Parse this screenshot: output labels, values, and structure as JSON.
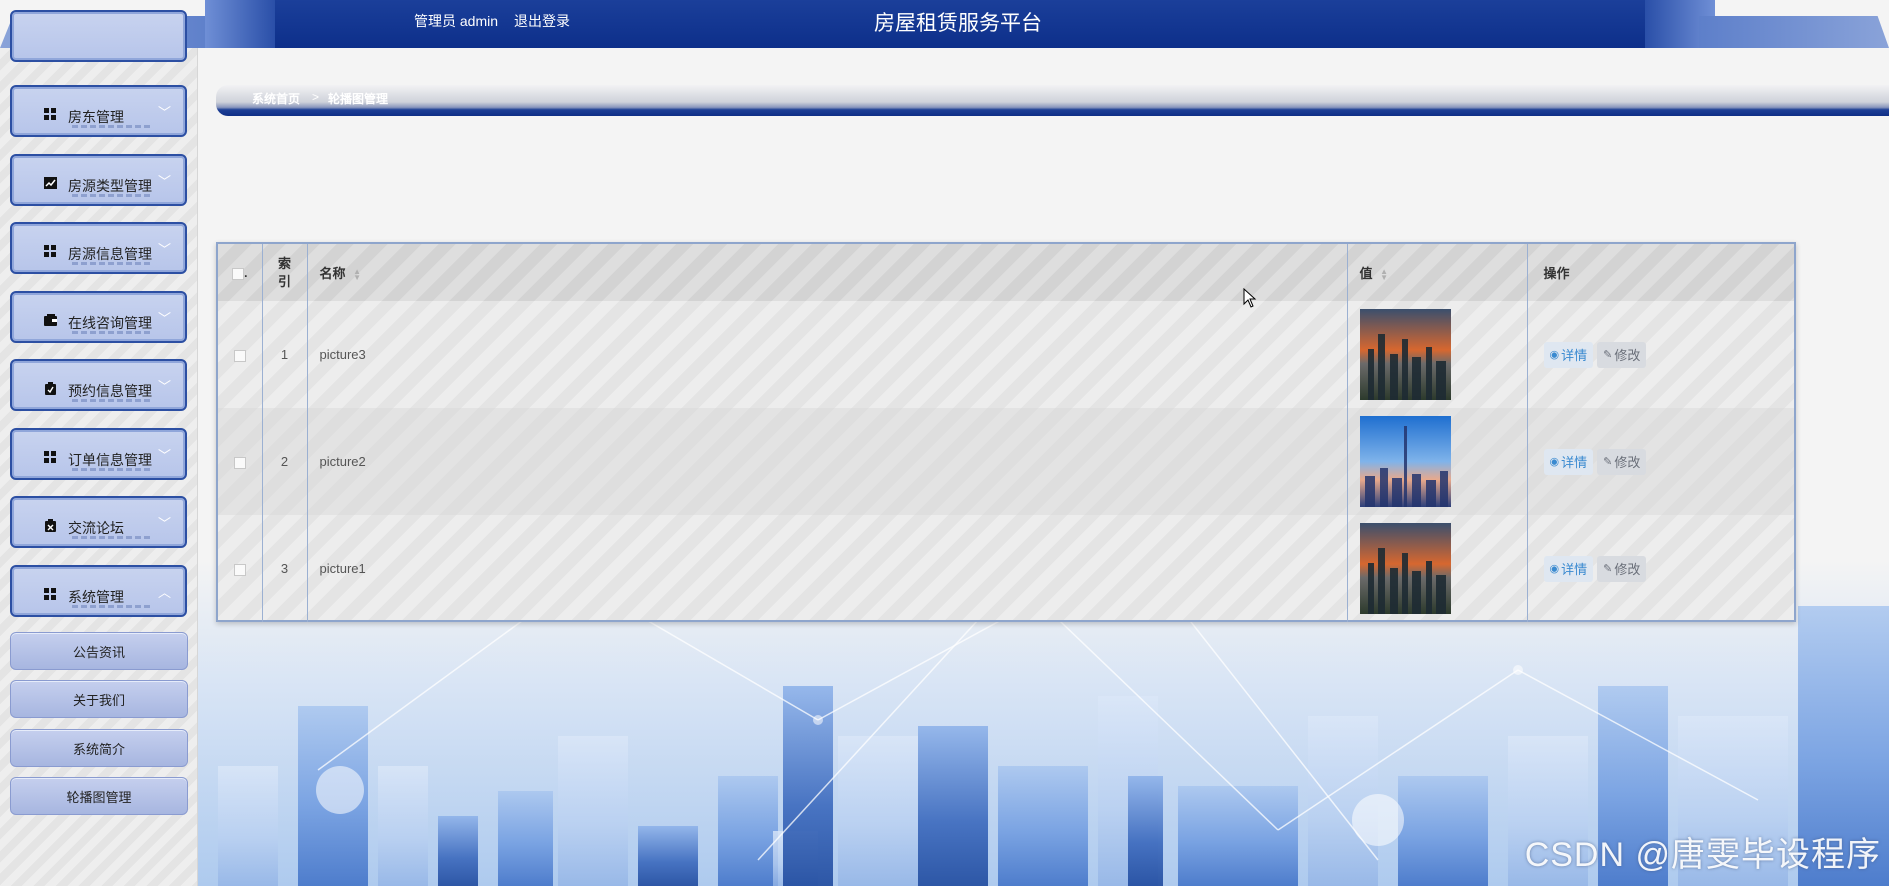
{
  "header": {
    "title": "房屋租赁服务平台",
    "admin_label": "管理员 admin",
    "logout_label": "退出登录"
  },
  "sidebar": {
    "items": [
      {
        "label": "房东管理",
        "icon": "grid-icon"
      },
      {
        "label": "房源类型管理",
        "icon": "chart-icon"
      },
      {
        "label": "房源信息管理",
        "icon": "grid-icon"
      },
      {
        "label": "在线咨询管理",
        "icon": "wallet-icon"
      },
      {
        "label": "预约信息管理",
        "icon": "clipboard-icon"
      },
      {
        "label": "订单信息管理",
        "icon": "grid-icon"
      },
      {
        "label": "交流论坛",
        "icon": "clipboard-icon"
      },
      {
        "label": "系统管理",
        "icon": "grid-icon",
        "expanded": true
      }
    ],
    "subitems": [
      {
        "label": "公告资讯"
      },
      {
        "label": "关于我们"
      },
      {
        "label": "系统简介"
      },
      {
        "label": "轮播图管理"
      }
    ]
  },
  "breadcrumb": {
    "home": "系统首页",
    "separator": ">",
    "current": "轮播图管理"
  },
  "table": {
    "headers": {
      "index": "索引",
      "name": "名称",
      "value": "值",
      "actions": "操作"
    },
    "rows": [
      {
        "index": "1",
        "name": "picture3",
        "image": "city-sunset"
      },
      {
        "index": "2",
        "name": "picture2",
        "image": "city-blue"
      },
      {
        "index": "3",
        "name": "picture1",
        "image": "city-sunset"
      }
    ],
    "detail_label": "详情",
    "edit_label": "修改"
  },
  "watermark": "CSDN @唐雯毕设程序",
  "colors": {
    "header_bg": "#0d2f8a",
    "menu_border": "#2c4fa3",
    "detail_text": "#3a8ad0"
  }
}
